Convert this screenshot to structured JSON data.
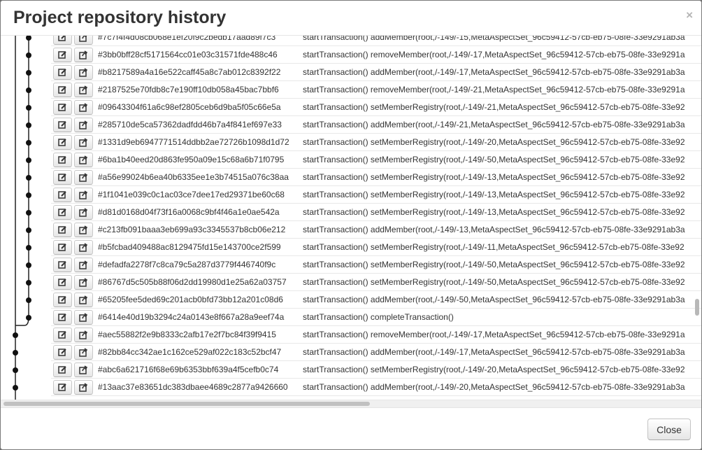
{
  "dialog": {
    "title": "Project repository history",
    "close_icon": "×",
    "close_button_label": "Close"
  },
  "row_buttons": {
    "first_icon": "edit-icon",
    "second_icon": "share-icon"
  },
  "commits": [
    {
      "hash": "#7c7f4f4d08cb068e1ef20f9c2bedb17aad89f7c3",
      "message": "startTransaction() addMember(root,/-149/-15,MetaAspectSet_96c59412-57cb-eb75-08fe-33e9291ab3a"
    },
    {
      "hash": "#3bb0bff28cf5171564cc01e03c31571fde488c46",
      "message": "startTransaction() removeMember(root,/-149/-17,MetaAspectSet_96c59412-57cb-eb75-08fe-33e9291a"
    },
    {
      "hash": "#b8217589a4a16e522caff45a8c7ab012c8392f22",
      "message": "startTransaction() addMember(root,/-149/-17,MetaAspectSet_96c59412-57cb-eb75-08fe-33e9291ab3a"
    },
    {
      "hash": "#2187525e70fdb8c7e190ff10db058a45bac7bbf6",
      "message": "startTransaction() removeMember(root,/-149/-21,MetaAspectSet_96c59412-57cb-eb75-08fe-33e9291a"
    },
    {
      "hash": "#09643304f61a6c98ef2805ceb6d9ba5f05c66e5a",
      "message": "startTransaction() setMemberRegistry(root,/-149/-21,MetaAspectSet_96c59412-57cb-eb75-08fe-33e92"
    },
    {
      "hash": "#285710de5ca57362dadfdd46b7a4f841ef697e33",
      "message": "startTransaction() addMember(root,/-149/-21,MetaAspectSet_96c59412-57cb-eb75-08fe-33e9291ab3a"
    },
    {
      "hash": "#1331d9eb6947771514ddbb2ae72726b1098d1d72",
      "message": "startTransaction() setMemberRegistry(root,/-149/-20,MetaAspectSet_96c59412-57cb-eb75-08fe-33e92"
    },
    {
      "hash": "#6ba1b40eed20d863fe950a09e15c68a6b71f0795",
      "message": "startTransaction() setMemberRegistry(root,/-149/-50,MetaAspectSet_96c59412-57cb-eb75-08fe-33e92"
    },
    {
      "hash": "#a56e99024b6ea40b6335ee1e3b74515a076c38aa",
      "message": "startTransaction() setMemberRegistry(root,/-149/-13,MetaAspectSet_96c59412-57cb-eb75-08fe-33e92"
    },
    {
      "hash": "#1f1041e039c0c1ac03ce7dee17ed29371be60c68",
      "message": "startTransaction() setMemberRegistry(root,/-149/-13,MetaAspectSet_96c59412-57cb-eb75-08fe-33e92"
    },
    {
      "hash": "#d81d0168d04f73f16a0068c9bf4f46a1e0ae542a",
      "message": "startTransaction() setMemberRegistry(root,/-149/-13,MetaAspectSet_96c59412-57cb-eb75-08fe-33e92"
    },
    {
      "hash": "#c213fb091baaa3eb699a93c3345537b8cb06e212",
      "message": "startTransaction() addMember(root,/-149/-13,MetaAspectSet_96c59412-57cb-eb75-08fe-33e9291ab3a"
    },
    {
      "hash": "#b5fcbad409488ac8129475fd15e143700ce2f599",
      "message": "startTransaction() setMemberRegistry(root,/-149/-11,MetaAspectSet_96c59412-57cb-eb75-08fe-33e92"
    },
    {
      "hash": "#defadfa2278f7c8ca79c5a287d3779f446740f9c",
      "message": "startTransaction() setMemberRegistry(root,/-149/-50,MetaAspectSet_96c59412-57cb-eb75-08fe-33e92"
    },
    {
      "hash": "#86767d5c505b88f06d2dd19980d1e25a62a03757",
      "message": "startTransaction() setMemberRegistry(root,/-149/-50,MetaAspectSet_96c59412-57cb-eb75-08fe-33e92"
    },
    {
      "hash": "#65205fee5ded69c201acb0bfd73bb12a201c08d6",
      "message": "startTransaction() addMember(root,/-149/-50,MetaAspectSet_96c59412-57cb-eb75-08fe-33e9291ab3a"
    },
    {
      "hash": "#6414e40d19b3294c24a0143e8f667a28a9eef74a",
      "message": "startTransaction() completeTransaction()"
    },
    {
      "hash": "#aec55882f2e9b8333c2afb17e2f7bc84f39f9415",
      "message": "startTransaction() removeMember(root,/-149/-17,MetaAspectSet_96c59412-57cb-eb75-08fe-33e9291a"
    },
    {
      "hash": "#82bb84cc342ae1c162ce529af022c183c52bcf47",
      "message": "startTransaction() addMember(root,/-149/-17,MetaAspectSet_96c59412-57cb-eb75-08fe-33e9291ab3a"
    },
    {
      "hash": "#abc6a621716f68e69b6353bbf639a4f5cefb0c74",
      "message": "startTransaction() setMemberRegistry(root,/-149/-20,MetaAspectSet_96c59412-57cb-eb75-08fe-33e92"
    },
    {
      "hash": "#13aac37e83651dc383dbaee4689c2877a9426660",
      "message": "startTransaction() addMember(root,/-149/-20,MetaAspectSet_96c59412-57cb-eb75-08fe-33e9291ab3a"
    }
  ]
}
